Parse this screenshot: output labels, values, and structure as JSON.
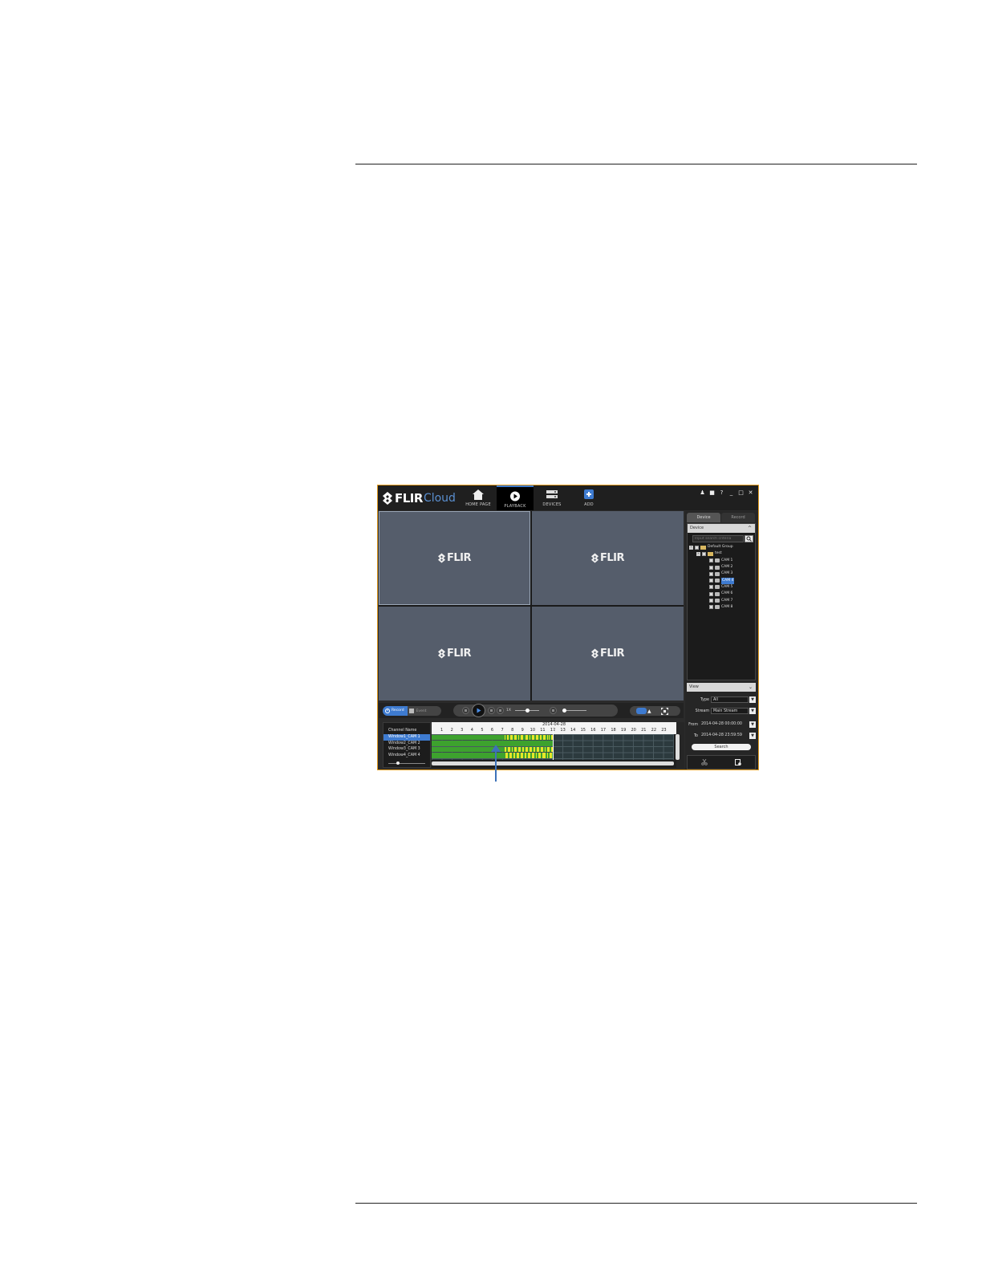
{
  "app": {
    "brand": "FLIR",
    "brand_suffix": "Cloud",
    "tile_logo_text": "FLIR"
  },
  "nav": [
    {
      "label": "HOME PAGE",
      "icon": "home-icon",
      "active": false
    },
    {
      "label": "PLAYBACK",
      "icon": "play-icon",
      "active": true
    },
    {
      "label": "DEVICES",
      "icon": "devices-icon",
      "active": false
    },
    {
      "label": "ADD",
      "icon": "add-icon",
      "active": false
    }
  ],
  "window_controls": [
    "user-icon",
    "lock-icon",
    "help-icon",
    "minimize-icon",
    "maximize-icon",
    "close-icon"
  ],
  "side_panel": {
    "tabs": [
      "Device",
      "Record"
    ],
    "device_header": "Device",
    "search_placeholder": "Input search criteria",
    "tree": {
      "root": "Default Group",
      "group": "test",
      "cameras": [
        "CAM 1",
        "CAM 2",
        "CAM 3",
        "CAM 4",
        "CAM 5",
        "CAM 6",
        "CAM 7",
        "CAM 8"
      ],
      "selected_camera": "CAM 4"
    },
    "view_header": "View",
    "type_label": "Type",
    "type_value": "All",
    "stream_label": "Stream",
    "stream_value": "Main Stream",
    "from_label": "From",
    "from_value": "2014-04-28 00:00:00",
    "to_label": "To",
    "to_value": "2014-04-28 23:59:59",
    "search_button": "Search"
  },
  "controls": {
    "record_label": "Record",
    "event_label": "Event",
    "speed": "1X"
  },
  "timeline": {
    "channel_header": "Channel Name",
    "channels": [
      "Window1_CAM 1",
      "Window2_CAM 2",
      "Window3_CAM 3",
      "Window4_CAM 4"
    ],
    "date": "2014-04-28",
    "hours": [
      "1",
      "2",
      "3",
      "4",
      "5",
      "6",
      "7",
      "8",
      "9",
      "10",
      "11",
      "12",
      "13",
      "14",
      "15",
      "16",
      "17",
      "18",
      "19",
      "20",
      "21",
      "22",
      "23"
    ],
    "record_end_hour": 12,
    "colors": {
      "recording": "#3da22e",
      "motion": "#e6e62a"
    }
  },
  "colors": {
    "accent": "#3e7bd0",
    "window_border": "#e09a1e",
    "tile_bg": "#555d6b",
    "annotation_arrow": "#3e72b8"
  }
}
